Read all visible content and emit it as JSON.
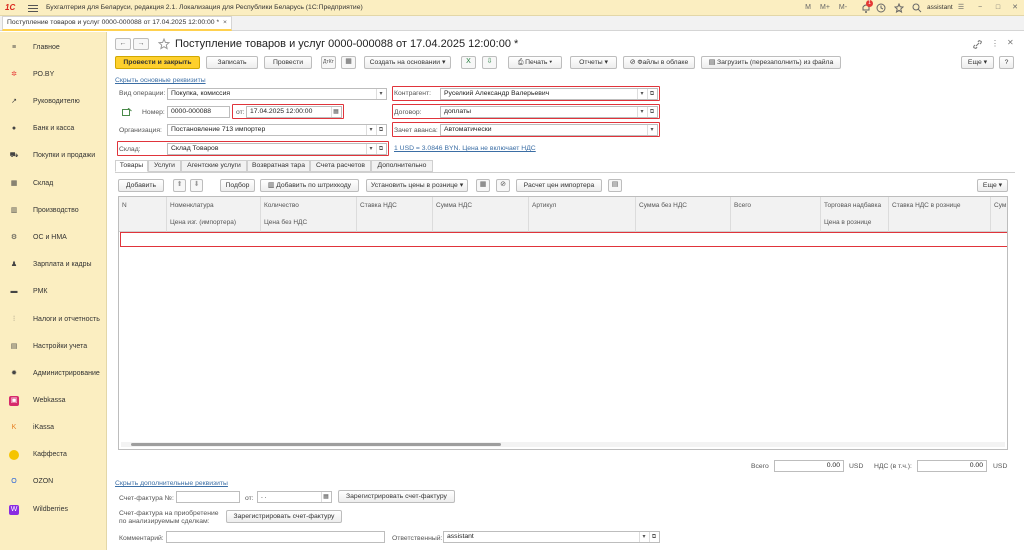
{
  "app": {
    "logo": "1С",
    "title": "Бухгалтерия для Беларуси, редакция 2.1. Локализация для Республики Беларусь   (1С:Предприятие)",
    "toolbar": [
      "M",
      "M+",
      "M-"
    ],
    "notifications": "1",
    "user": "assistant",
    "window_controls": [
      "−",
      "□",
      "✕"
    ]
  },
  "tab": {
    "label": "Поступление товаров и услуг 0000-000088 от 17.04.2025 12:00:00 *",
    "close": "×"
  },
  "sidebar": {
    "items": [
      {
        "label": "Главное",
        "icon": "≡"
      },
      {
        "label": "РО.BY",
        "icon": "✲"
      },
      {
        "label": "Руководителю",
        "icon": "↗"
      },
      {
        "label": "Банк и касса",
        "icon": "●"
      },
      {
        "label": "Покупки и продажи",
        "icon": "⛟"
      },
      {
        "label": "Склад",
        "icon": "▦"
      },
      {
        "label": "Производство",
        "icon": "▥"
      },
      {
        "label": "ОС и НМА",
        "icon": "⚙"
      },
      {
        "label": "Зарплата и кадры",
        "icon": "♟"
      },
      {
        "label": "РМК",
        "icon": "▬"
      },
      {
        "label": "Налоги и отчетность",
        "icon": "⫶"
      },
      {
        "label": "Настройки учета",
        "icon": "▤"
      },
      {
        "label": "Администрирование",
        "icon": "✹"
      },
      {
        "label": "Webkassa",
        "icon": "▣"
      },
      {
        "label": "iKassa",
        "icon": "K"
      },
      {
        "label": "Каффеста",
        "icon": "●"
      },
      {
        "label": "OZON",
        "icon": "O"
      },
      {
        "label": "Wildberries",
        "icon": "W"
      }
    ]
  },
  "doc": {
    "title": "Поступление товаров и услуг 0000-000088 от 17.04.2025 12:00:00 *",
    "more": "Еще",
    "help": "?"
  },
  "toolbar": {
    "post_close": "Провести и закрыть",
    "save": "Записать",
    "post": "Провести",
    "create_based": "Создать на основании",
    "print": "Печать",
    "reports": "Отчеты",
    "cloud": "Файлы в облаке",
    "load": "Загрузить (перезаполнить) из файла",
    "more": "Еще"
  },
  "form": {
    "hide_main": "Скрыть основные реквизиты",
    "op_label": "Вид операции:",
    "op_value": "Покупка, комиссия",
    "num_label": "Номер:",
    "num_value": "0000-000088",
    "date_label": "от:",
    "date_value": "17.04.2025 12:00:00",
    "org_label": "Организация:",
    "org_value": "Постановление 713 импортер",
    "wh_label": "Склад:",
    "wh_value": "Склад Товаров",
    "ctr_label": "Контрагент:",
    "ctr_value": "Руселкий Александр Валерьевич",
    "agr_label": "Договор:",
    "agr_value": "доплаты",
    "adv_label": "Зачет аванса:",
    "adv_value": "Автоматически",
    "currency_link": "1 USD = 3.0846 BYN. Цена не включает НДС"
  },
  "tabs": [
    "Товары",
    "Услуги",
    "Агентские услуги",
    "Возвратная тара",
    "Счета расчетов",
    "Дополнительно"
  ],
  "grid_toolbar": {
    "add": "Добавить",
    "pick": "Подбор",
    "barcode": "Добавить по штрихкоду",
    "set_prices": "Установить цены в рознице",
    "calc": "Расчет цен импортера",
    "more": "Еще"
  },
  "grid": {
    "columns": [
      {
        "top": "N",
        "bottom": ""
      },
      {
        "top": "Номенклатура",
        "bottom": "Цена изг. (импортера)"
      },
      {
        "top": "Количество",
        "bottom": "Цена без НДС"
      },
      {
        "top": "Ставка НДС",
        "bottom": ""
      },
      {
        "top": "Сумма НДС",
        "bottom": ""
      },
      {
        "top": "Артикул",
        "bottom": ""
      },
      {
        "top": "Сумма без НДС",
        "bottom": ""
      },
      {
        "top": "Всего",
        "bottom": ""
      },
      {
        "top": "Торговая надбавка",
        "bottom": "Цена в рознице"
      },
      {
        "top": "Ставка НДС в рознице",
        "bottom": ""
      },
      {
        "top": "Сум",
        "bottom": ""
      }
    ]
  },
  "totals": {
    "total_label": "Всего",
    "total_value": "0.00",
    "currency": "USD",
    "vat_label": "НДС (в т.ч.):",
    "vat_value": "0.00"
  },
  "extra": {
    "hide_extra": "Скрыть дополнительные реквизиты",
    "invoice_label": "Счет-фактура №:",
    "invoice_value": "",
    "from_label": "от:",
    "from_value": " .  .    ",
    "reg_invoice": "Зарегистрировать счет-фактуру",
    "invoice2_label_1": "Счет-фактура на приобретение",
    "invoice2_label_2": "по анализируемым сделкам:",
    "reg_invoice2": "Зарегистрировать счет-фактуру",
    "comment_label": "Комментарий:",
    "comment_value": "",
    "resp_label": "Ответственный:",
    "resp_value": "assistant"
  }
}
